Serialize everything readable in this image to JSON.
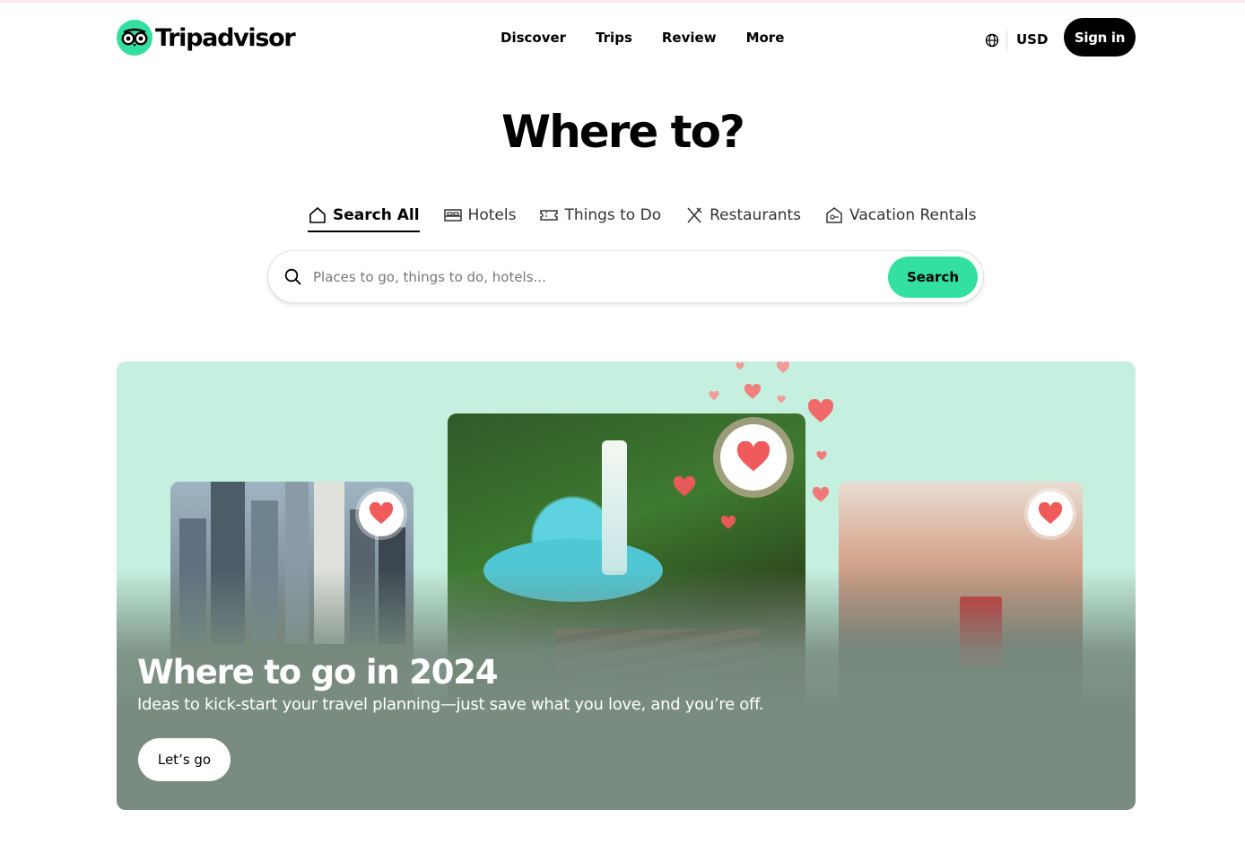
{
  "header": {
    "logo_text": "Tripadvisor",
    "nav": [
      "Discover",
      "Trips",
      "Review",
      "More"
    ],
    "currency": "USD",
    "signin_label": "Sign in"
  },
  "hero": {
    "title": "Where to?",
    "tabs": [
      {
        "label": "Search All",
        "icon": "home-icon",
        "active": true
      },
      {
        "label": "Hotels",
        "icon": "bed-icon",
        "active": false
      },
      {
        "label": "Things to Do",
        "icon": "ticket-icon",
        "active": false
      },
      {
        "label": "Restaurants",
        "icon": "utensils-icon",
        "active": false
      },
      {
        "label": "Vacation Rentals",
        "icon": "house-key-icon",
        "active": false
      }
    ],
    "search": {
      "placeholder": "Places to go, things to do, hotels...",
      "button_label": "Search"
    }
  },
  "promo": {
    "title": "Where to go in 2024",
    "subtitle": "Ideas to kick-start your travel planning—just save what you love, and you’re off.",
    "button_label": "Let’s go",
    "colors": {
      "background": "#c5f0df",
      "heart": "#f05a5a",
      "accent": "#34e0a1"
    }
  }
}
